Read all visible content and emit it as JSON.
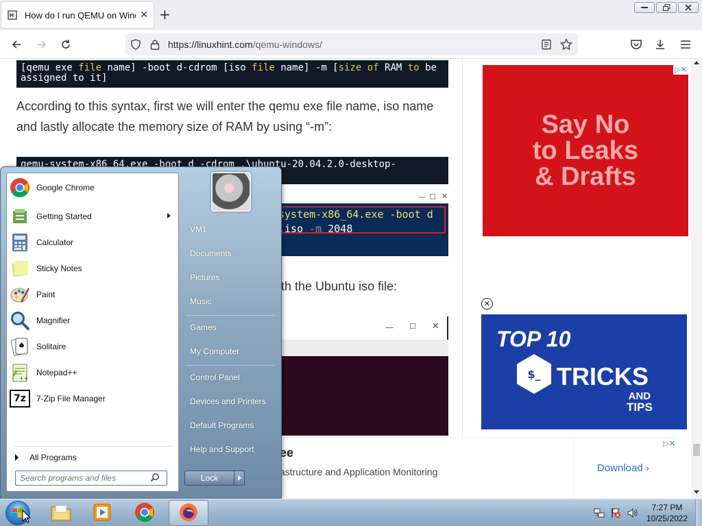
{
  "browser": {
    "tab_title": "How do I run QEMU on Windows",
    "url_host": "https://linuxhint.com",
    "url_path": "/qemu-windows/"
  },
  "article": {
    "code1_parts": [
      "[qemu exe ",
      "file",
      " name]  -boot d-cdrom [iso ",
      "file",
      " name]  -m [",
      "size",
      " ",
      "of",
      " RAM ",
      "to",
      " be assigned to it]"
    ],
    "para1": "According to this syntax, first we will enter the qemu exe file name, iso name and lastly allocate the memory size of RAM by using “-m”:",
    "code2": "qemu-system-x86_64.exe -boot d -cdrom .\\ubuntu-20.04.2.0-desktop-",
    "shot_cmd1": "system-x86_64.exe -boot d",
    "shot_cmd2_a": ".iso ",
    "shot_cmd2_b": "-m",
    "shot_cmd2_c": " 2048",
    "para2": "th the Ubuntu iso file:"
  },
  "ads": {
    "ad1_lines": [
      "Say No",
      "to Leaks",
      "& Drafts"
    ],
    "ad2_top": "TOP 10",
    "ad2_tricks": "TRICKS",
    "ad2_and": "AND",
    "ad2_tips": "TIPS",
    "ad2_hex": "$_",
    "bottom_heading": "ee",
    "bottom_sub": "astructure and Application Monitoring",
    "bottom_cta": "Download"
  },
  "start_menu": {
    "programs": [
      {
        "label": "Google Chrome",
        "icon": "chrome-icon"
      },
      {
        "label": "Getting Started",
        "icon": "getting-started-icon",
        "submenu": true
      },
      {
        "label": "Calculator",
        "icon": "calculator-icon"
      },
      {
        "label": "Sticky Notes",
        "icon": "sticky-notes-icon"
      },
      {
        "label": "Paint",
        "icon": "paint-icon"
      },
      {
        "label": "Magnifier",
        "icon": "magnifier-icon"
      },
      {
        "label": "Solitaire",
        "icon": "solitaire-icon"
      },
      {
        "label": "Notepad++",
        "icon": "notepadpp-icon"
      },
      {
        "label": "7-Zip File Manager",
        "icon": "7zip-icon",
        "icon_text": "7z"
      }
    ],
    "all_programs": "All Programs",
    "search_placeholder": "Search programs and files",
    "right_items": [
      "VM1",
      "Documents",
      "Pictures",
      "Music",
      "Games",
      "My Computer",
      "Control Panel",
      "Devices and Printers",
      "Default Programs",
      "Help and Support"
    ],
    "lock_label": "Lock"
  },
  "taskbar": {
    "time": "7:27 PM",
    "date": "10/25/2022"
  },
  "colors": {
    "ad1_bg": "#d41219",
    "ad2_bg": "#1b3fa6",
    "code_bg": "#111827",
    "code_keyword": "#e0c24a"
  }
}
